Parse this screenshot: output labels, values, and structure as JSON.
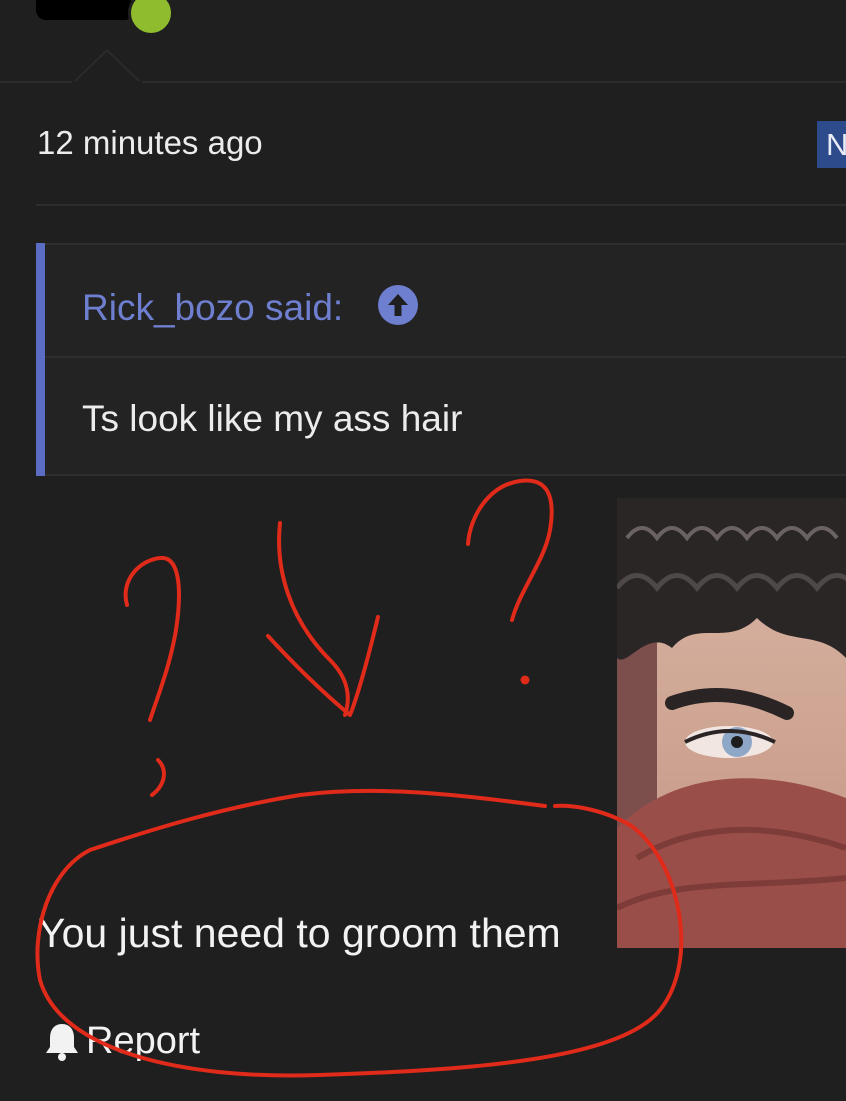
{
  "post": {
    "timestamp": "12 minutes ago",
    "badge": "N",
    "online_color": "#8fbb2f"
  },
  "quote": {
    "author_line": "Rick_bozo said:",
    "body": "Ts look like my ass hair",
    "accent_color": "#5b6dc3"
  },
  "reply": {
    "text": "You just need to groom them"
  },
  "actions": {
    "report_label": "Report"
  },
  "icons": {
    "quote_jump": "arrow-up-circle-icon",
    "report": "bell-icon"
  },
  "annotation_color": "#e02a1a"
}
